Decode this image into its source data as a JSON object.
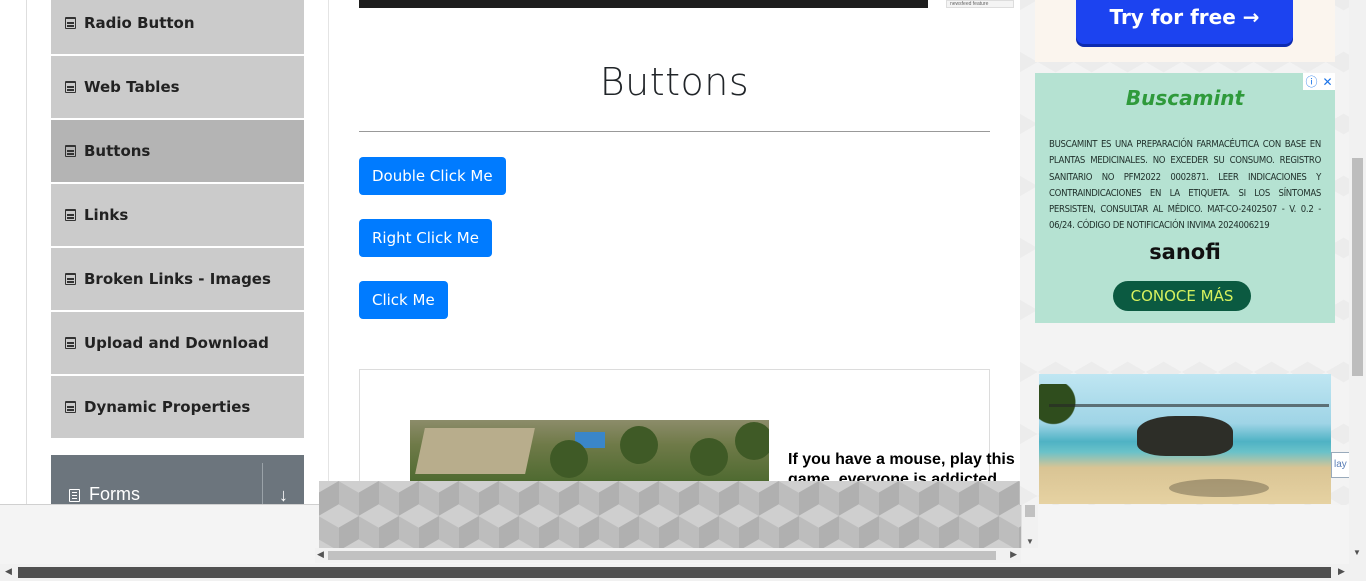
{
  "sidebar": {
    "items": [
      {
        "label": "Radio Button",
        "icon": "html5-icon"
      },
      {
        "label": "Web Tables",
        "icon": "html5-icon"
      },
      {
        "label": "Buttons",
        "icon": "html5-icon",
        "active": true
      },
      {
        "label": "Links",
        "icon": "html5-icon"
      },
      {
        "label": "Broken Links - Images",
        "icon": "html5-icon"
      },
      {
        "label": "Upload and Download",
        "icon": "html5-icon"
      },
      {
        "label": "Dynamic Properties",
        "icon": "html5-icon"
      }
    ],
    "forms_group": {
      "label": "Forms",
      "icon": "document-icon",
      "toggle_icon": "arrow-down-icon"
    }
  },
  "main": {
    "title": "Buttons",
    "buttons": {
      "double_click": "Double Click Me",
      "right_click": "Right Click Me",
      "click": "Click Me"
    },
    "ad_text": "If you have a mouse, play this game. everyone is addicted",
    "top_thumb_text": "newsfeed feature"
  },
  "right_ads": {
    "try_button": "Try for free →",
    "buscamint": {
      "logo": "Buscamint",
      "text": "BUSCAMINT ES UNA PREPARACIÓN FARMACÉUTICA CON BASE EN PLANTAS MEDICINALES. NO EXCEDER SU CONSUMO. REGISTRO SANITARIO NO PFM2022 0002871. LEER INDICACIONES Y CONTRAINDICACIONES EN LA ETIQUETA. SI LOS SÍNTOMAS PERSISTEN, CONSULTAR AL MÉDICO. MAT-CO-2402507 - V. 0.2 - 06/24. CÓDIGO DE NOTIFICACIÓN INVIMA 2024006219",
      "brand": "sanofi",
      "cta": "CONOCE MÁS",
      "info_icon": "info-icon",
      "close_icon": "close-icon"
    },
    "edge_link_text": "lay g"
  },
  "colors": {
    "primary_button": "#007bff",
    "sidebar_item": "#cbcbcb",
    "sidebar_active": "#b4b4b4",
    "forms_group": "#6c757d",
    "try_button": "#1c43f0",
    "buscamint_bg": "#b5e2d2",
    "buscamint_cta": "#0b5a41"
  }
}
